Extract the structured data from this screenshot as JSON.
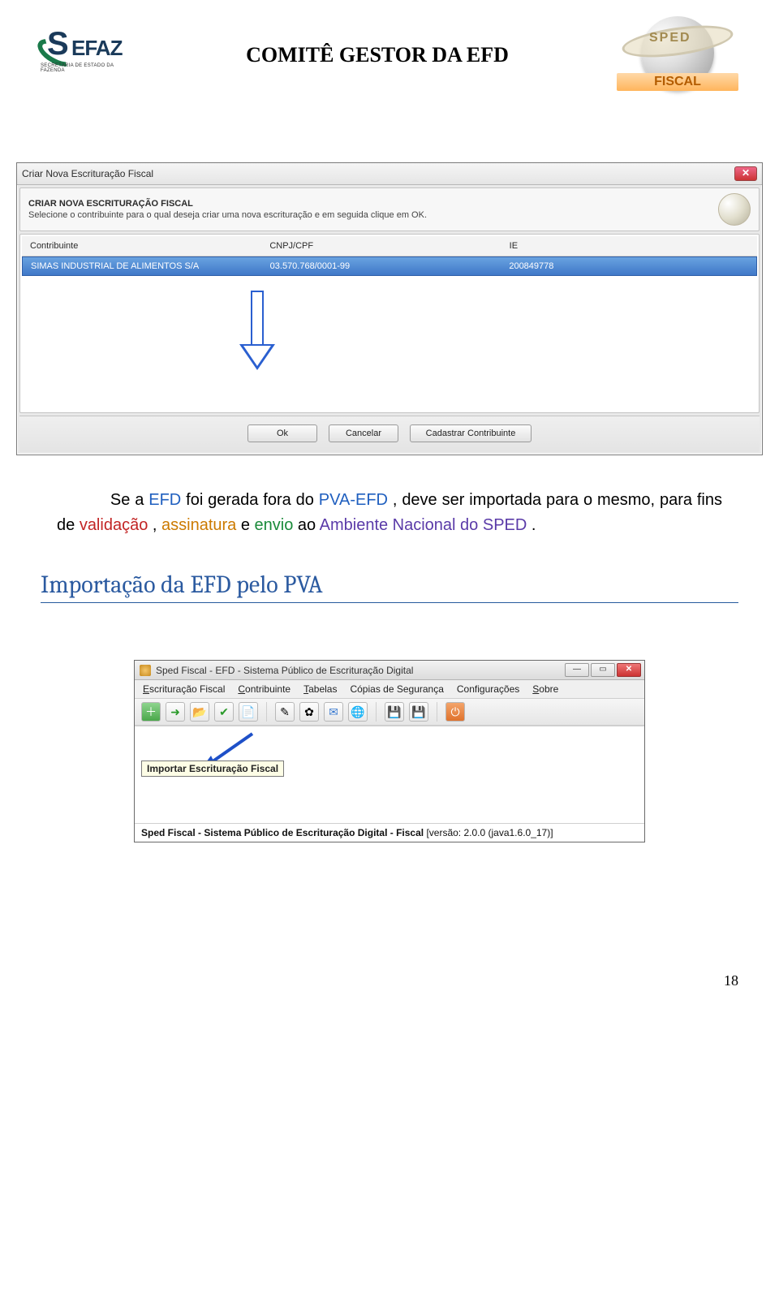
{
  "header": {
    "sefaz_text": "EFAZ",
    "sefaz_s": "S",
    "sefaz_sub": "SECRETARIA DE ESTADO DA FAZENDA",
    "title": "COMITÊ GESTOR DA EFD",
    "sped_ring": "SPED",
    "sped_fiscal": "FISCAL"
  },
  "dialog": {
    "title": "Criar Nova Escrituração Fiscal",
    "heading": "CRIAR NOVA ESCRITURAÇÃO FISCAL",
    "subtitle": "Selecione o contribuinte para o qual deseja criar uma nova escrituração e em seguida clique em OK.",
    "columns": {
      "c1": "Contribuinte",
      "c2": "CNPJ/CPF",
      "c3": "IE"
    },
    "row": {
      "c1": "SIMAS INDUSTRIAL DE ALIMENTOS S/A",
      "c2": "03.570.768/0001-99",
      "c3": "200849778"
    },
    "buttons": {
      "ok": "Ok",
      "cancel": "Cancelar",
      "new": "Cadastrar Contribuinte"
    }
  },
  "paragraph": {
    "p1a": "Se a ",
    "p1b": "EFD",
    "p1c": " foi gerada fora do ",
    "p1d": "PVA-EFD",
    "p1e": ", deve ser importada para o mesmo, para fins de ",
    "p2a": "validação",
    "p2b": ", ",
    "p2c": "assinatura",
    "p2d": " e ",
    "p2e": "envio",
    "p2f": " ao ",
    "p2g": "Ambiente Nacional do SPED",
    "p2h": "."
  },
  "section_heading": "Importação da EFD pelo PVA",
  "app": {
    "title": "Sped Fiscal - EFD - Sistema Público de Escrituração Digital",
    "menu": {
      "m1": "Escrituração Fiscal",
      "m2": "Contribuinte",
      "m3": "Tabelas",
      "m4": "Cópias de Segurança",
      "m5": "Configurações",
      "m6": "Sobre"
    },
    "tooltip": "Importar Escrituração Fiscal",
    "status_bold": "Sped Fiscal - Sistema Público de Escrituração Digital - Fiscal",
    "status_rest": " [versão: 2.0.0 (java1.6.0_17)]"
  },
  "page_number": "18"
}
